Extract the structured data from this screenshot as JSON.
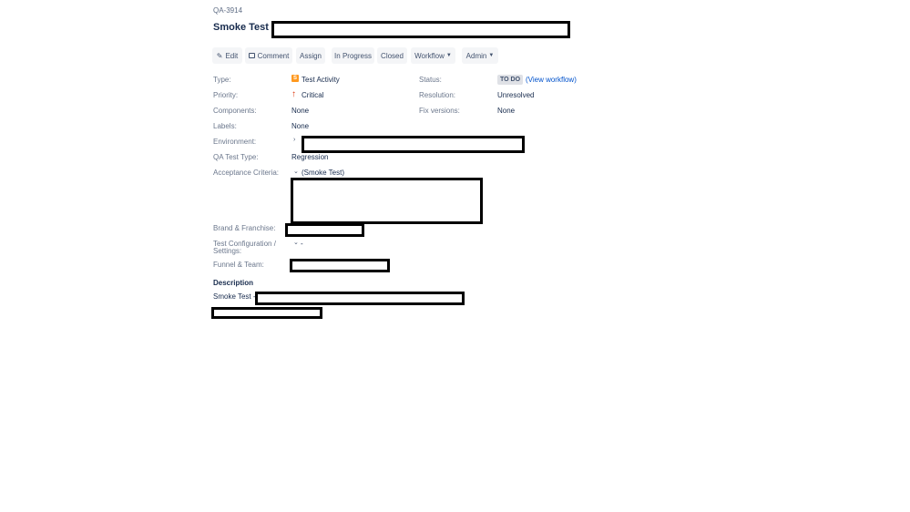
{
  "issue": {
    "key": "QA-3914",
    "title": "Smoke Test -"
  },
  "toolbar": {
    "edit": "Edit",
    "comment": "Comment",
    "assign": "Assign",
    "in_progress": "In Progress",
    "closed": "Closed",
    "workflow": "Workflow",
    "admin": "Admin"
  },
  "fields": {
    "type_label": "Type:",
    "type_value": "Test Activity",
    "status_label": "Status:",
    "status_value": "TO DO",
    "view_workflow": "(View workflow)",
    "priority_label": "Priority:",
    "priority_value": "Critical",
    "resolution_label": "Resolution:",
    "resolution_value": "Unresolved",
    "components_label": "Components:",
    "components_value": "None",
    "fix_versions_label": "Fix versions:",
    "fix_versions_value": "None",
    "labels_label": "Labels:",
    "labels_value": "None",
    "environment_label": "Environment:",
    "qa_test_type_label": "QA Test Type:",
    "qa_test_type_value": "Regression",
    "acceptance_label": "Acceptance Criteria:",
    "acceptance_value": "(Smoke Test)",
    "brand_label": "Brand & Franchise:",
    "test_config_label_1": "Test Configuration /",
    "test_config_label_2": "Settings:",
    "test_config_value": "-",
    "funnel_label": "Funnel & Team:"
  },
  "description": {
    "heading": "Description",
    "text": "Smoke Test -"
  },
  "colors": {
    "link": "#0052cc",
    "type_icon": "#ff991f",
    "priority_icon": "#de350b",
    "redaction": "#000000"
  },
  "icons": {
    "edit": "pencil-icon",
    "comment": "comment-icon",
    "type": "test-activity-icon",
    "priority": "arrow-up-icon"
  }
}
